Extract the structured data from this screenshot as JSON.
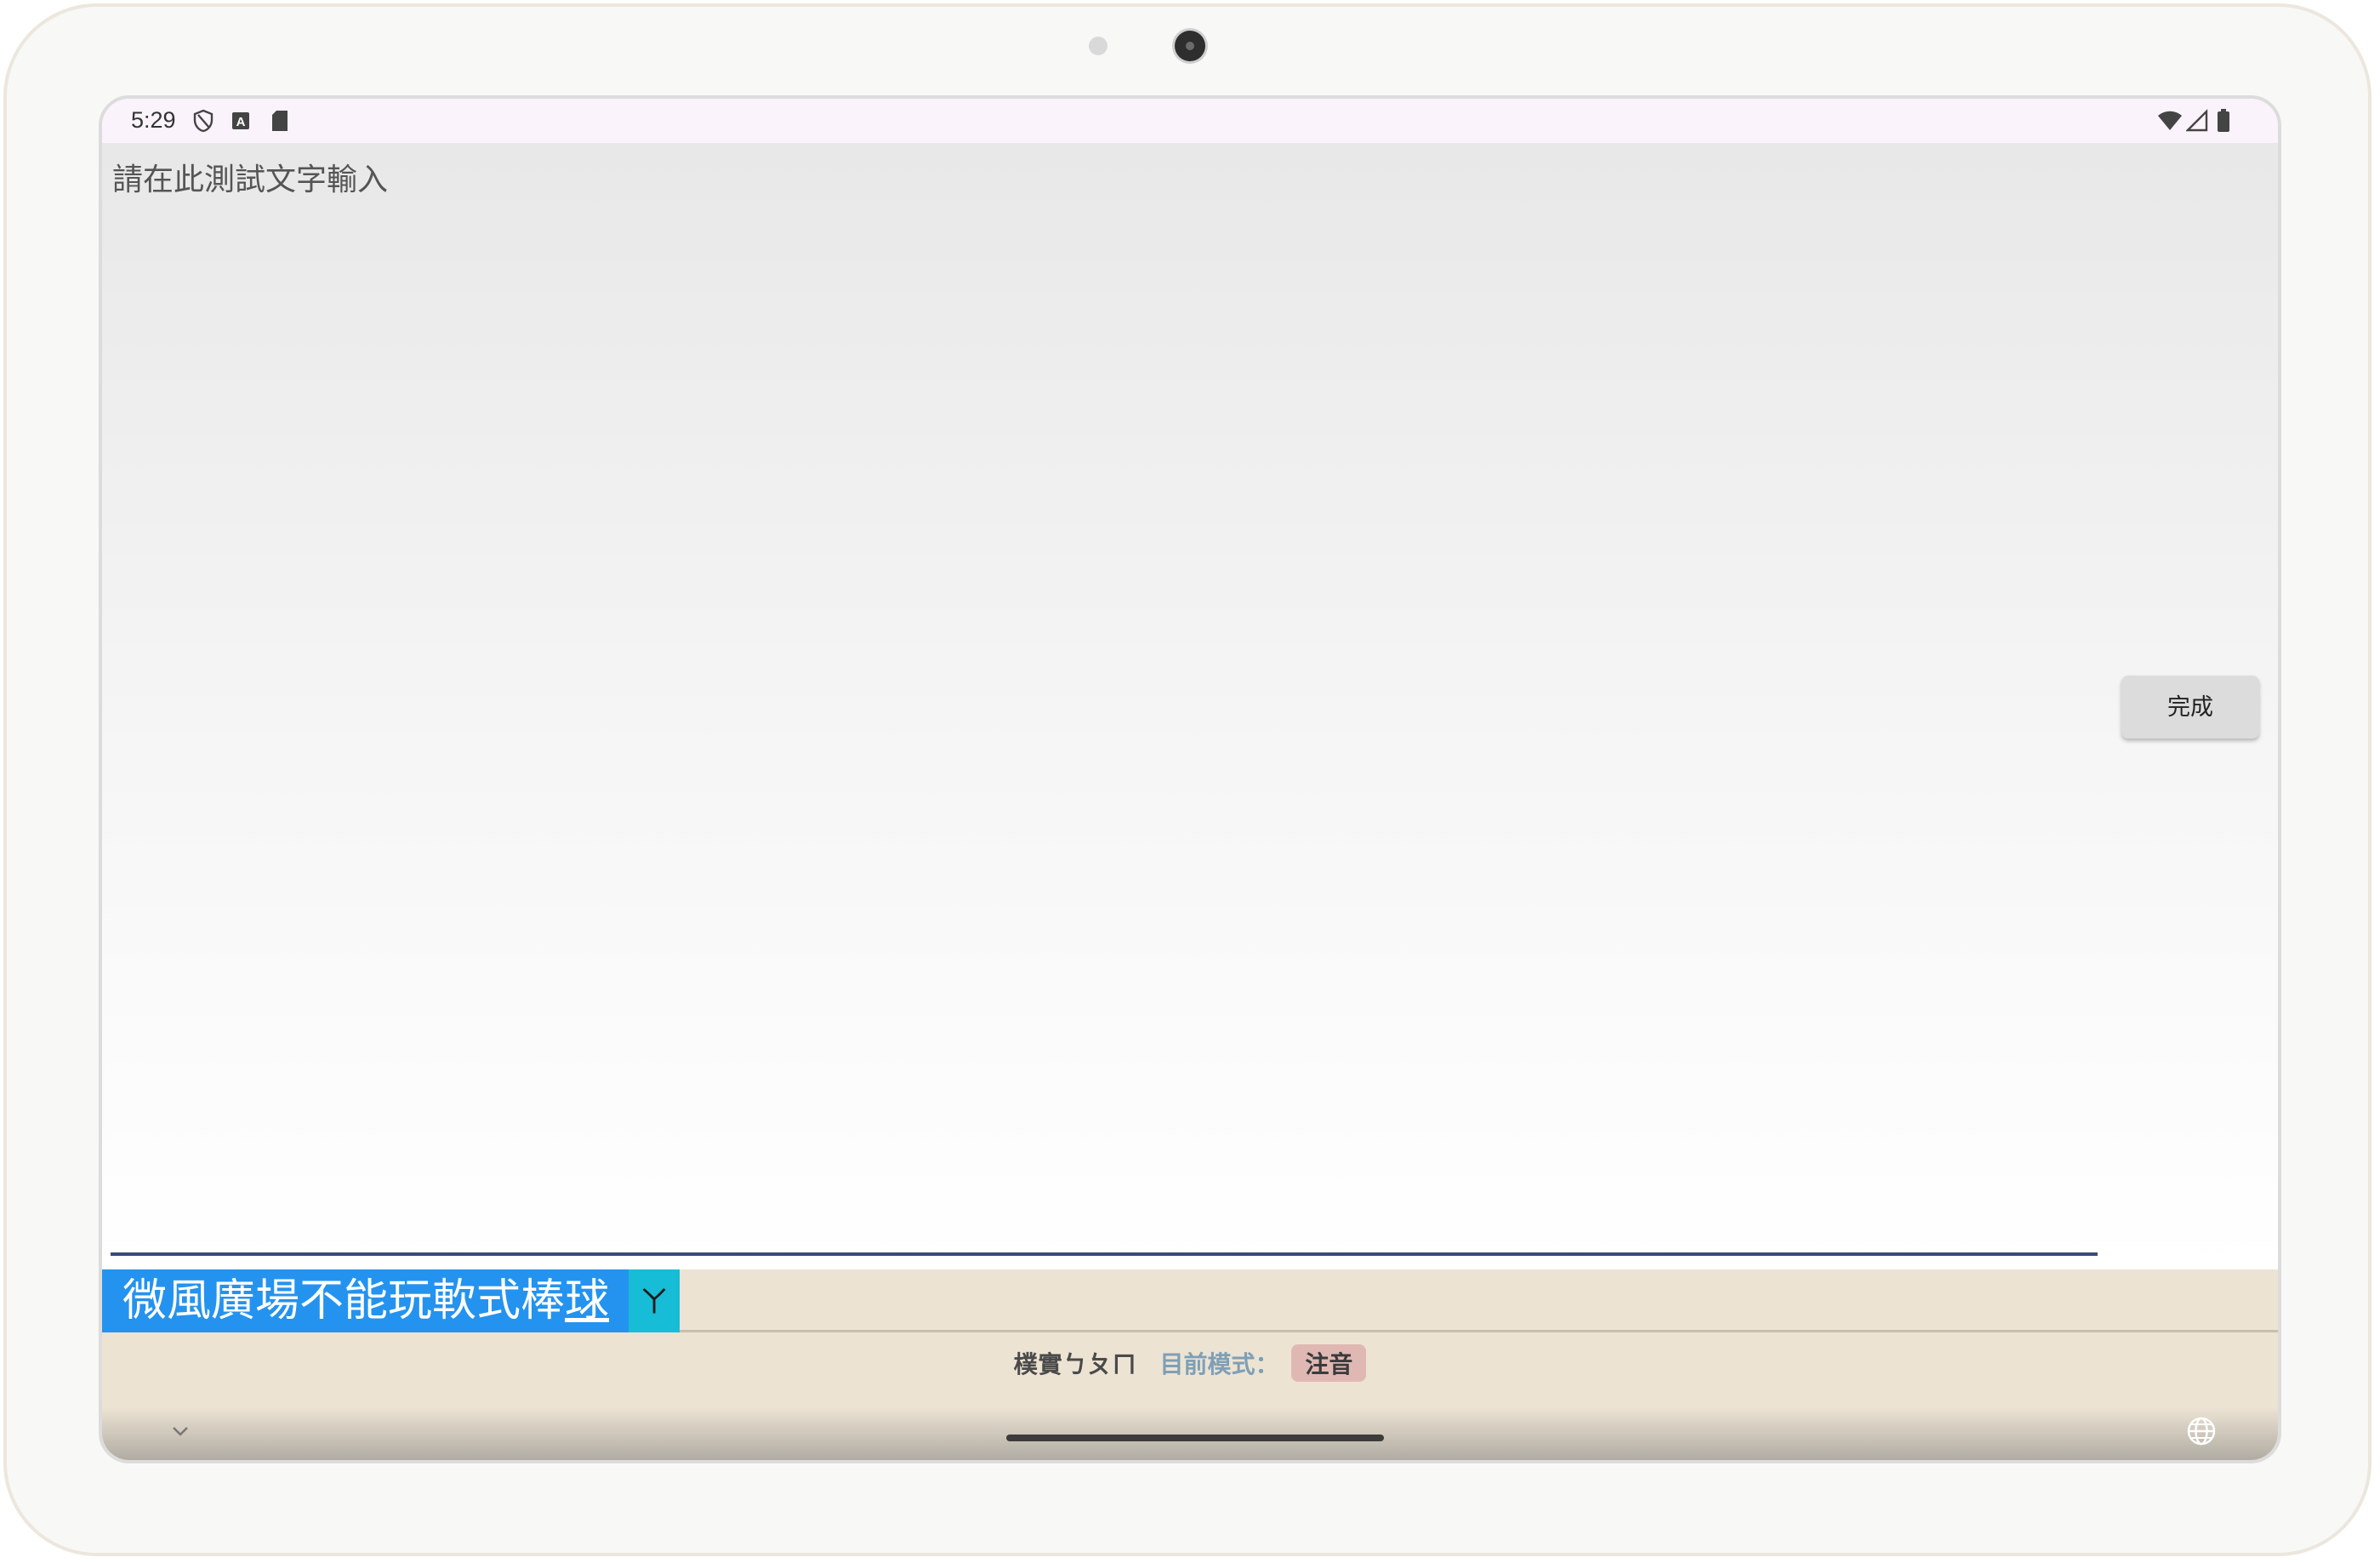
{
  "status_bar": {
    "time": "5:29",
    "left_icons": [
      "shield-icon",
      "a-box-icon",
      "sd-card-icon"
    ],
    "right_icons": [
      "wifi-icon",
      "signal-icon",
      "battery-icon"
    ]
  },
  "text_field": {
    "value": "請在此測試文字輸入"
  },
  "buttons": {
    "done_label": "完成"
  },
  "keyboard": {
    "candidate_main": "微風廣場不能玩軟式棒",
    "candidate_cursor_char": "球",
    "candidate_tail": "ㄚ",
    "brand": "樸實ㄅㄆㄇ",
    "mode_label": "目前模式：",
    "mode_value": "注音",
    "icons": [
      "chevron-down-icon",
      "globe-icon"
    ]
  },
  "colors": {
    "candidate_bg": "#2493ef",
    "candidate_tail_bg": "#17bcd6",
    "keyboard_bg": "#ece3d3",
    "mode_badge_bg": "#e0b8b3",
    "field_underline": "#3a4a7a"
  }
}
